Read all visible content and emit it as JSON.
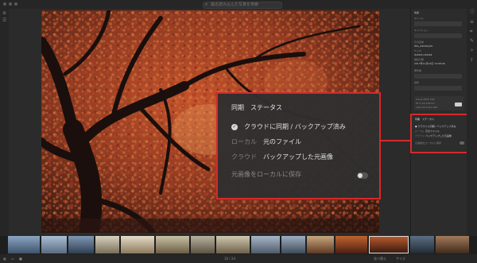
{
  "toolbar": {
    "search_placeholder": "最近読み込んだ写真を検索"
  },
  "info_panel": {
    "section_title": "情報",
    "title_label": "タイトル",
    "caption_label": "キャプション",
    "filename_label": "元の名前",
    "filename": "IMG_####.JPG",
    "size_label": "サイズ",
    "size": "####×####",
    "date_label": "撮影日時",
    "date": "2017年11月23日 13:08:26",
    "copyright_label": "著作権",
    "location_label": "場所",
    "camera": "Canon EOS 70D",
    "lens": "EF-S 18-135mm",
    "exposure": "1/60 f/5.6 ISO 400",
    "edit_label": "編集"
  },
  "status_mini": {
    "title": "同期　ステータス",
    "line1": "クラウドに同期 / バックアップ済み",
    "line2_label": "ローカル",
    "line2_value": "元のファイル",
    "line3_label": "クラウド",
    "line3_value": "バックアップした元画像",
    "save_label": "元画像をローカルに保存"
  },
  "status_callout": {
    "title": "同期　ステータス",
    "line1": "クラウドに同期 / バックアップ済み",
    "line2_label": "ローカル",
    "line2_value": "元のファイル",
    "line3_label": "クラウド",
    "line3_value": "バックアップした元画像",
    "save_label": "元画像をローカルに保存",
    "save_toggle_on": false
  },
  "bottom": {
    "page_indicator": "10 / 24",
    "sort_label": "並べ替え",
    "size_label": "サイズ"
  },
  "colors": {
    "highlight": "#d42a2a",
    "panel_bg": "#2c2c2c",
    "app_bg": "#262626"
  },
  "icons": [
    "menu-icon",
    "search-icon",
    "info-icon",
    "edit-icon",
    "crop-icon",
    "brush-icon",
    "share-icon",
    "check-icon",
    "grid-icon",
    "filmstrip-icon"
  ]
}
